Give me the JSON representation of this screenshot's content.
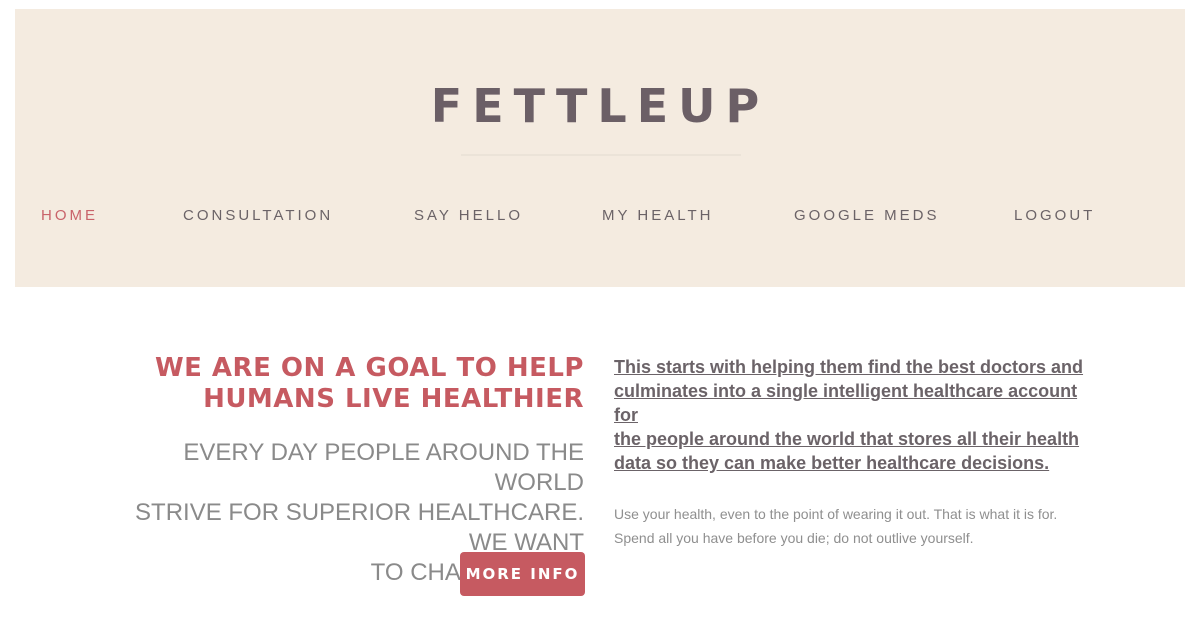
{
  "header": {
    "logo": "FETTLEUP"
  },
  "nav": {
    "items": [
      {
        "label": "HOME"
      },
      {
        "label": "CONSULTATION"
      },
      {
        "label": "SAY HELLO"
      },
      {
        "label": "MY HEALTH"
      },
      {
        "label": "GOOGLE MEDS"
      },
      {
        "label": "LOGOUT"
      }
    ]
  },
  "hero": {
    "headline_line1": "WE ARE ON A GOAL TO HELP",
    "headline_line2": "HUMANS LIVE HEALTHIER",
    "subhead_line1": "EVERY DAY PEOPLE AROUND THE WORLD",
    "subhead_line2": "STRIVE FOR SUPERIOR HEALTHCARE. WE WANT",
    "subhead_line3": "TO CHANGE THAT.",
    "button_label": "MORE INFO",
    "lead_line1": "This starts with helping them find the best doctors and",
    "lead_line2": "culminates into a single intelligent healthcare account for",
    "lead_line3": "the people around the world that stores all their health",
    "lead_line4": "data so they can make better healthcare decisions.",
    "quote_line1": "Use your health, even to the point of wearing it out. That is what it is for.",
    "quote_line2": "Spend all you have before you die; do not outlive yourself."
  },
  "colors": {
    "accent": "#c65a61",
    "header_bg": "#f4ebe0",
    "logo": "#6b5f66",
    "nav_text": "#6b6367"
  }
}
